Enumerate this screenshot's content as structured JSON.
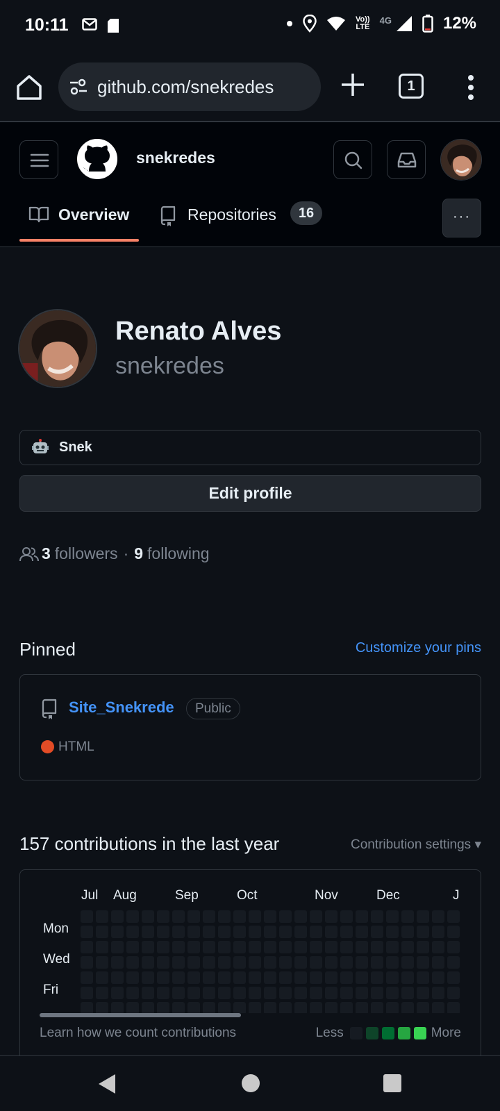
{
  "status_bar": {
    "time": "10:11",
    "battery": "12%",
    "network_top": "Vo))",
    "network_bottom": "LTE",
    "network_gen": "4G"
  },
  "browser": {
    "url": "github.com/snekredes",
    "tab_count": "1"
  },
  "header": {
    "username": "snekredes",
    "tabs": [
      {
        "label": "Overview",
        "active": true
      },
      {
        "label": "Repositories",
        "count": "16"
      }
    ],
    "more_label": "···"
  },
  "profile": {
    "name": "Renato Alves",
    "login": "snekredes",
    "status_text": "Snek",
    "edit_profile_label": "Edit profile",
    "followers_count": "3",
    "followers_label": "followers",
    "separator": "·",
    "following_count": "9",
    "following_label": "following"
  },
  "pinned": {
    "title": "Pinned",
    "customize_label": "Customize your pins",
    "repo": {
      "name": "Site_Snekrede",
      "visibility": "Public",
      "language": "HTML",
      "language_color": "#e34c26"
    }
  },
  "contributions": {
    "title": "157 contributions in the last year",
    "settings_label": "Contribution settings ▾",
    "months": [
      "Jul",
      "Aug",
      "Sep",
      "Oct",
      "Nov",
      "Dec",
      "J"
    ],
    "days": [
      "Mon",
      "Wed",
      "Fri"
    ],
    "learn_label": "Learn how we count contributions",
    "legend_less": "Less",
    "legend_more": "More",
    "legend_colors": [
      "#161b22",
      "#0e4429",
      "#006d32",
      "#26a641",
      "#39d353"
    ]
  },
  "colors": {
    "background": "#0d1117",
    "header": "#010409",
    "accent_link": "#4493f8",
    "tab_underline": "#f78166"
  }
}
